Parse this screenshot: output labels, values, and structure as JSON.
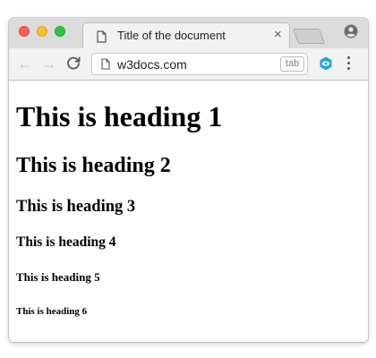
{
  "browser": {
    "tab": {
      "title": "Title of the document",
      "close_glyph": "×"
    },
    "toolbar": {
      "back_glyph": "←",
      "forward_glyph": "→",
      "url": "w3docs.com",
      "tab_hint": "tab"
    },
    "icons": {
      "tab_page": "document-icon",
      "omnibox_page": "page-icon",
      "profile": "profile-icon",
      "extension": "extension-icon",
      "menu": "menu-icon",
      "reload": "reload-icon"
    },
    "colors": {
      "close_red": "#fc5f57",
      "minimize_yellow": "#fdbc2e",
      "maximize_green": "#29c840",
      "extension_blue": "#1ea7e8"
    }
  },
  "page": {
    "headings": [
      "This is heading 1",
      "This is heading 2",
      "This is heading 3",
      "This is heading 4",
      "This is heading 5",
      "This is heading 6"
    ]
  }
}
